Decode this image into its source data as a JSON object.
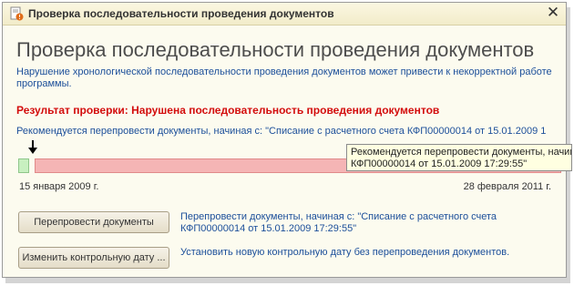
{
  "window": {
    "title": "Проверка последовательности проведения документов",
    "close_glyph": "✕"
  },
  "main": {
    "heading": "Проверка последовательности проведения документов",
    "description": "Нарушение хронологической последовательности проведения документов может привести к некорректной работе программы.",
    "result": "Результат проверки: Нарушена последовательность проведения документов",
    "recommendation": "Рекомендуется перепровести документы, начиная с: \"Списание с расчетного счета КФП00000014 от 15.01.2009 1",
    "tooltip_line1": "Рекомендуется перепровести документы, начин",
    "tooltip_line2": "КФП00000014 от 15.01.2009 17:29:55\"",
    "date_start": "15 января 2009 г.",
    "date_end": "28 февраля 2011 г."
  },
  "timeline": {
    "ok_color": "#c8f0c0",
    "bad_color": "#f5b5b5"
  },
  "actions": {
    "repost_button": "Перепровести документы",
    "repost_text": "Перепровести документы, начиная с: \"Списание с расчетного счета КФП00000014 от 15.01.2009 17:29:55\"",
    "change_button": "Изменить контрольную дату ...",
    "change_text": "Установить новую контрольную дату без перепроведения документов."
  },
  "icons": {
    "title_icon": "document-warning-icon",
    "arrow": "arrow-down-icon"
  }
}
